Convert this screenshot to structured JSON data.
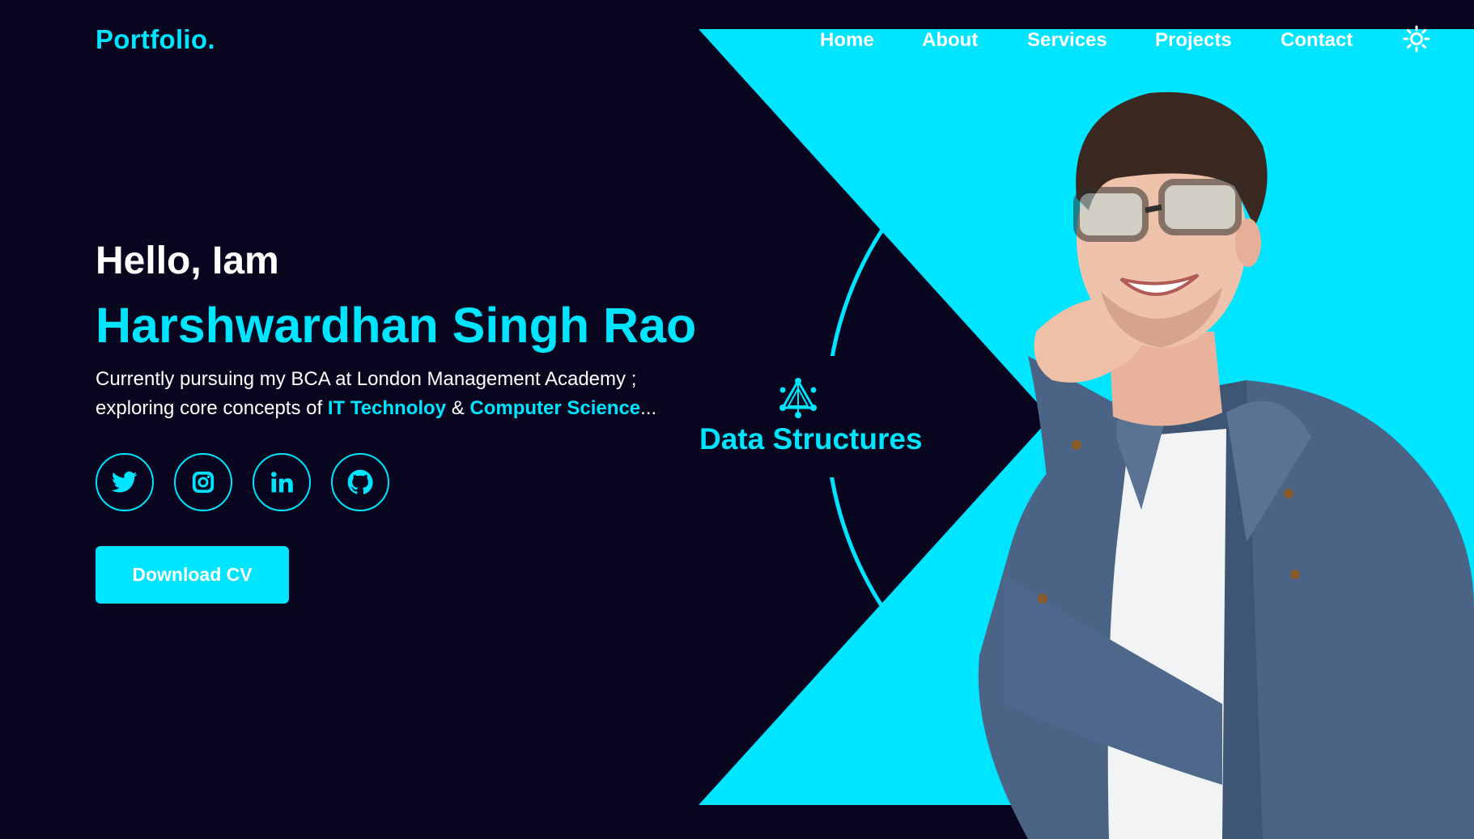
{
  "header": {
    "logo": "Portfolio.",
    "nav": [
      {
        "label": "Home"
      },
      {
        "label": "About"
      },
      {
        "label": "Services"
      },
      {
        "label": "Projects"
      },
      {
        "label": "Contact"
      }
    ],
    "theme_toggle_icon": "sun-icon"
  },
  "hero": {
    "greeting": "Hello, Iam",
    "name": "Harshwardhan Singh Rao",
    "description_line1": "Currently pursuing my BCA at London Management Academy ;",
    "description_prefix": "exploring core concepts of ",
    "highlight1": "IT Technoloy",
    "connector": " & ",
    "highlight2": "Computer Science",
    "suffix": "...",
    "socials": [
      {
        "icon": "twitter-icon"
      },
      {
        "icon": "instagram-icon"
      },
      {
        "icon": "linkedin-icon"
      },
      {
        "icon": "github-icon"
      }
    ],
    "cv_button": "Download CV"
  },
  "rotating_skill": {
    "icon": "graph-network-icon",
    "label": "Data Structures"
  },
  "colors": {
    "background": "#08051f",
    "accent": "#00e5ff",
    "text": "#ffffff"
  }
}
